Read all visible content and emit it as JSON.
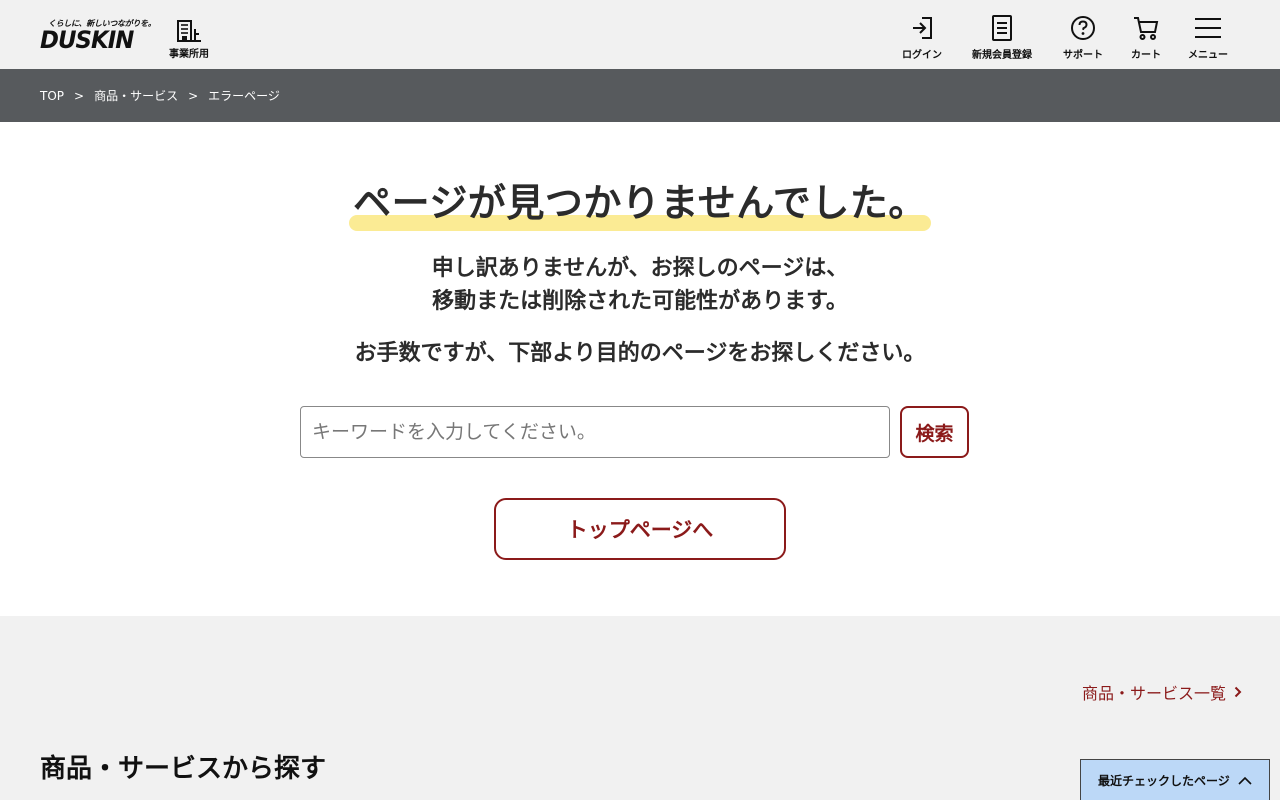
{
  "header": {
    "logo_tagline": "くらしに、新しいつながりを。",
    "logo_word": "DUSKIN",
    "business_label": "事業所用",
    "nav": [
      {
        "label": "ログイン",
        "icon": "login-icon"
      },
      {
        "label": "新規会員登録",
        "icon": "register-icon"
      },
      {
        "label": "サポート",
        "icon": "help-icon"
      },
      {
        "label": "カート",
        "icon": "cart-icon"
      },
      {
        "label": "メニュー",
        "icon": "menu-icon"
      }
    ]
  },
  "breadcrumb": {
    "items": [
      "TOP",
      "商品・サービス",
      "エラーページ"
    ],
    "separator": ">"
  },
  "error": {
    "title": "ページが見つかりませんでした。",
    "message_line1": "申し訳ありませんが、お探しのページは、",
    "message_line2": "移動または削除された可能性があります。",
    "message_line3": "お手数ですが、下部より目的のページをお探しください。",
    "search_placeholder": "キーワードを入力してください。",
    "search_value": "",
    "search_button": "検索",
    "top_button": "トップページへ"
  },
  "lower": {
    "list_link": "商品・サービス一覧",
    "section_title": "商品・サービスから探す",
    "recent_tab": "最近チェックしたページ"
  },
  "colors": {
    "accent": "#8b1a1a",
    "highlight": "#fbeb94",
    "breadcrumb_bg": "#575a5d",
    "recent_bg": "#bcd8f7"
  }
}
